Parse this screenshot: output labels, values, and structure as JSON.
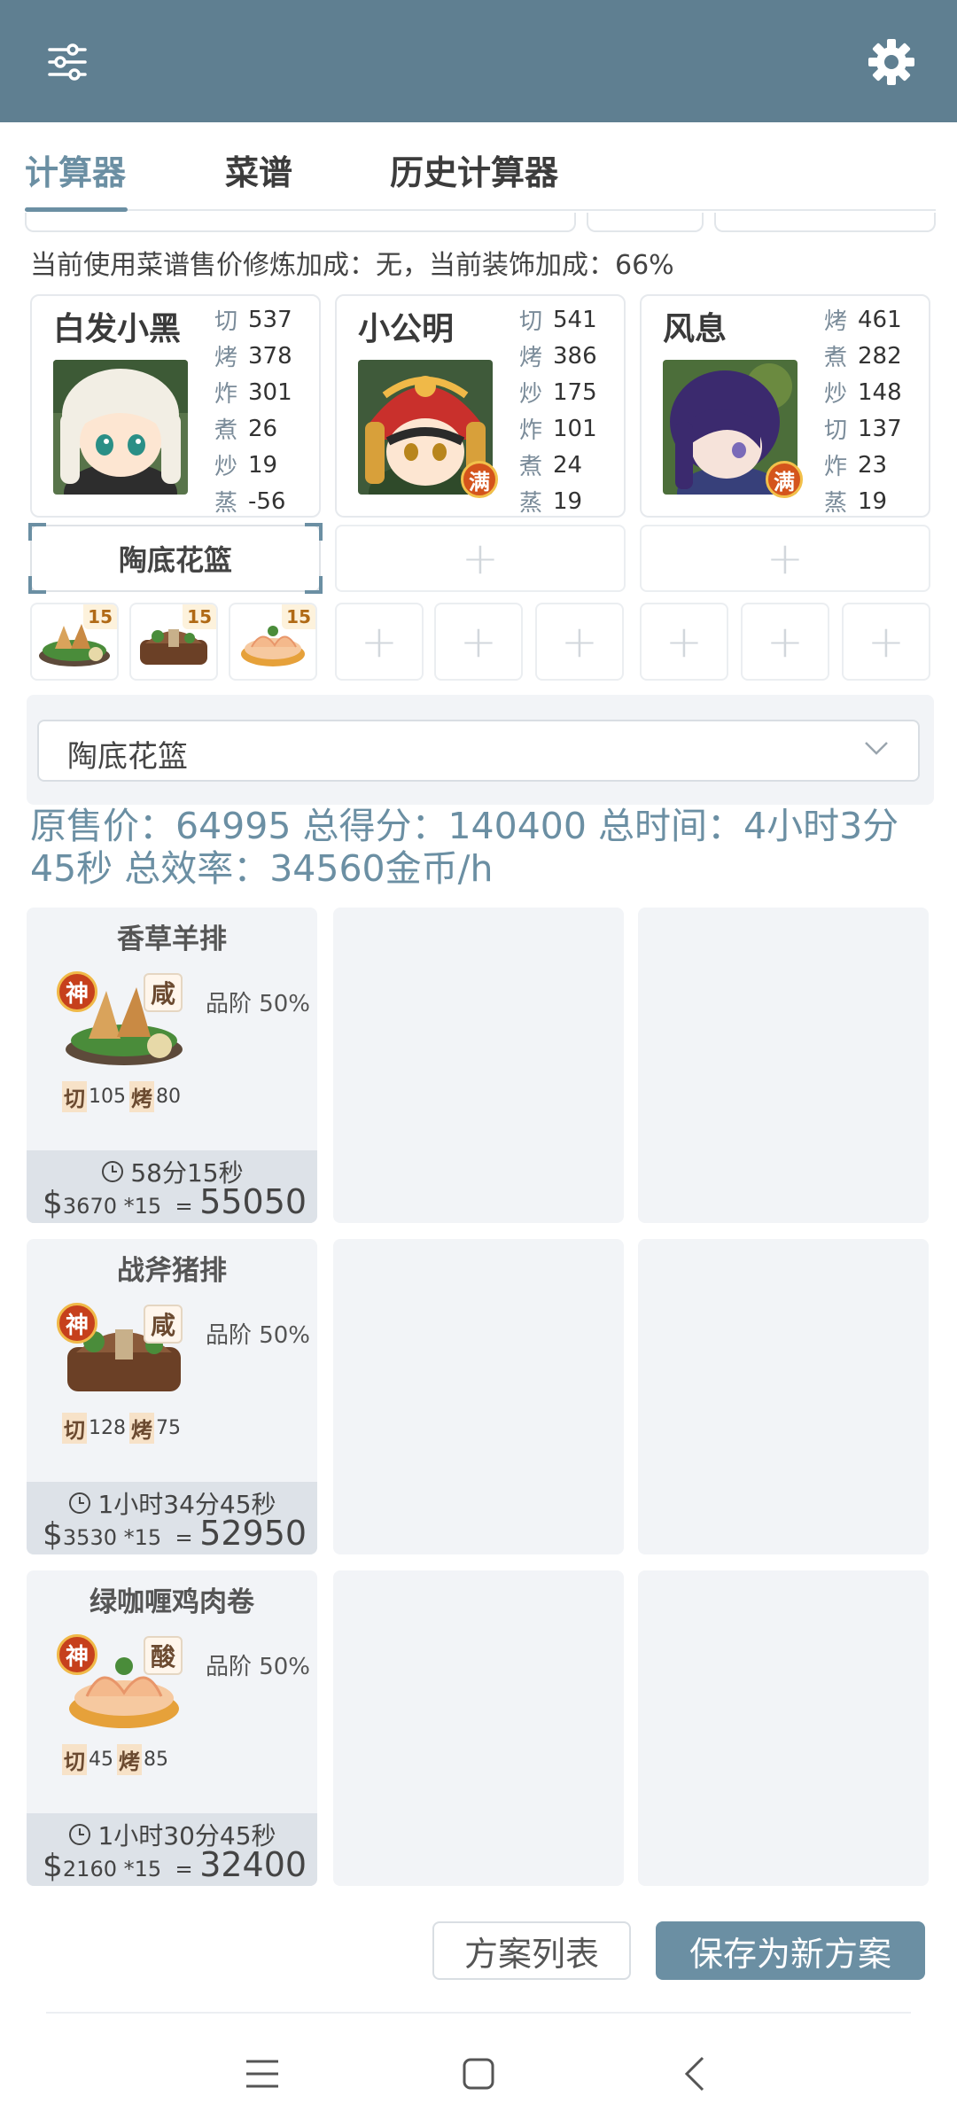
{
  "tabs": [
    {
      "label": "计算器",
      "active": true
    },
    {
      "label": "菜谱",
      "active": false
    },
    {
      "label": "历史计算器",
      "active": false
    }
  ],
  "info_line": "当前使用菜谱售价修炼加成：无，当前装饰加成：66%",
  "chefs": [
    {
      "name": "白发小黑",
      "badge": "",
      "stats": [
        [
          "切",
          "537"
        ],
        [
          "烤",
          "378"
        ],
        [
          "炸",
          "301"
        ],
        [
          "煮",
          "26"
        ],
        [
          "炒",
          "19"
        ],
        [
          "蒸",
          "-56"
        ]
      ]
    },
    {
      "name": "小公明",
      "badge": "满",
      "stats": [
        [
          "切",
          "541"
        ],
        [
          "烤",
          "386"
        ],
        [
          "炒",
          "175"
        ],
        [
          "炸",
          "101"
        ],
        [
          "煮",
          "24"
        ],
        [
          "蒸",
          "19"
        ]
      ]
    },
    {
      "name": "风息",
      "badge": "满",
      "stats": [
        [
          "烤",
          "461"
        ],
        [
          "煮",
          "282"
        ],
        [
          "炒",
          "148"
        ],
        [
          "切",
          "137"
        ],
        [
          "炸",
          "23"
        ],
        [
          "蒸",
          "19"
        ]
      ]
    }
  ],
  "equip_selected": "陶底花篮",
  "recipe_counts": [
    "15",
    "15",
    "15"
  ],
  "select_value": "陶底花篮",
  "summary_text": "原售价：64995 总得分：140400 总时间：4小时3分45秒 总效率：34560金币/h",
  "recipes": [
    {
      "name": "香草羊排",
      "god": "神",
      "taste": "咸",
      "grade": "品阶 50%",
      "req": [
        [
          "切",
          "105"
        ],
        [
          "烤",
          "80"
        ]
      ],
      "time": "58分15秒",
      "price": "3670",
      "mult": "*15",
      "eq": "=",
      "total": "55050"
    },
    {
      "name": "战斧猪排",
      "god": "神",
      "taste": "咸",
      "grade": "品阶 50%",
      "req": [
        [
          "切",
          "128"
        ],
        [
          "烤",
          "75"
        ]
      ],
      "time": "1小时34分45秒",
      "price": "3530",
      "mult": "*15",
      "eq": "=",
      "total": "52950"
    },
    {
      "name": "绿咖喱鸡肉卷",
      "god": "神",
      "taste": "酸",
      "grade": "品阶 50%",
      "req": [
        [
          "切",
          "45"
        ],
        [
          "烤",
          "85"
        ]
      ],
      "time": "1小时30分45秒",
      "price": "2160",
      "mult": "*15",
      "eq": "=",
      "total": "32400"
    }
  ],
  "dollar": "$",
  "buttons": {
    "plans": "方案列表",
    "save": "保存为新方案"
  },
  "icons": {
    "menu": "sliders-icon",
    "settings": "gear-icon"
  }
}
